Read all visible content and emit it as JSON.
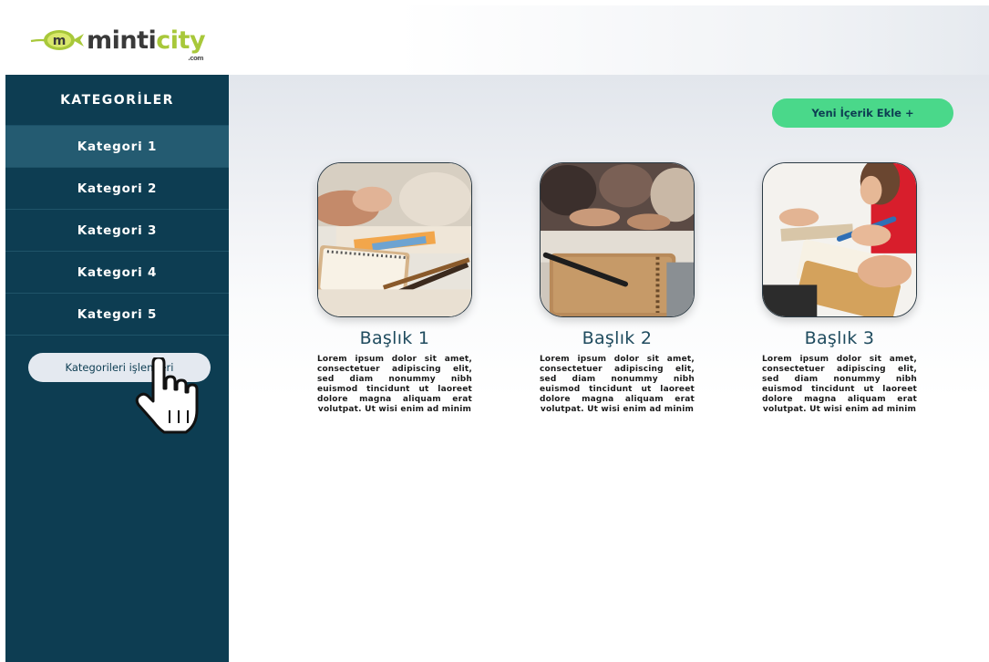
{
  "brand": {
    "name_part1": "minti",
    "name_part2": "city",
    "logo_letter": "m",
    "domain_suffix": ".com"
  },
  "sidebar": {
    "title": "KATEGORİLER",
    "items": [
      {
        "label": "Kategori 1"
      },
      {
        "label": "Kategori 2"
      },
      {
        "label": "Kategori 3"
      },
      {
        "label": "Kategori 4"
      },
      {
        "label": "Kategori 5"
      }
    ],
    "action_label": "Kategorileri işlemleri"
  },
  "main": {
    "add_button_label": "Yeni İçerik Ekle +",
    "cards": [
      {
        "title": "Başlık 1",
        "text": "Lorem ipsum dolor sit amet, consectetuer adipiscing elit, sed diam nonummy nibh euismod tincidunt ut laoreet dolore magna aliquam erat volutpat. Ut wisi enim ad minim",
        "image_icon": "study-photo-notebook-pencils"
      },
      {
        "title": "Başlık 2",
        "text": "Lorem ipsum dolor sit amet, consectetuer adipiscing elit, sed diam nonummy nibh euismod tincidunt ut laoreet dolore magna aliquam erat volutpat. Ut wisi enim ad minim",
        "image_icon": "study-photo-notebook-pen"
      },
      {
        "title": "Başlık 3",
        "text": "Lorem ipsum dolor sit amet, consectetuer adipiscing elit, sed diam nonummy nibh euismod tincidunt ut laoreet dolore magna aliquam erat volutpat. Ut wisi enim ad minim",
        "image_icon": "study-photo-student-writing"
      }
    ]
  },
  "colors": {
    "sidebar_bg": "#0d3d52",
    "accent_green": "#4ad88a",
    "brand_green": "#a8c83a",
    "title_color": "#1f4b5e"
  }
}
